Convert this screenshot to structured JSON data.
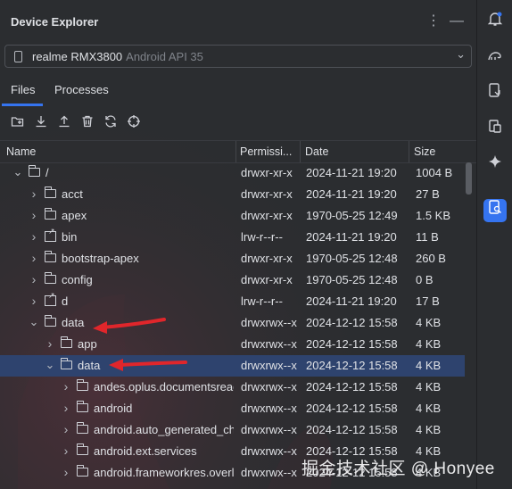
{
  "panel": {
    "title": "Device Explorer",
    "more_icon": "more-vertical-icon",
    "minimize_icon": "minimize-icon"
  },
  "device": {
    "name": "realme RMX3800",
    "api": "Android API 35"
  },
  "tabs": [
    {
      "label": "Files",
      "active": true
    },
    {
      "label": "Processes",
      "active": false
    }
  ],
  "toolbar": [
    "new-folder-icon",
    "download-icon",
    "upload-icon",
    "delete-icon",
    "sync-icon",
    "target-icon"
  ],
  "columns": [
    "Name",
    "Permissi...",
    "Date",
    "Size"
  ],
  "rows": [
    {
      "name": "/",
      "perm": "drwxr-xr-x",
      "date": "2024-11-21 19:20",
      "size": "1004 B",
      "depth": 0,
      "expanded": true,
      "type": "folder"
    },
    {
      "name": "acct",
      "perm": "drwxr-xr-x",
      "date": "2024-11-21 19:20",
      "size": "27 B",
      "depth": 1,
      "expanded": false,
      "type": "folder"
    },
    {
      "name": "apex",
      "perm": "drwxr-xr-x",
      "date": "1970-05-25 12:49",
      "size": "1.5 KB",
      "depth": 1,
      "expanded": false,
      "type": "folder"
    },
    {
      "name": "bin",
      "perm": "lrw-r--r--",
      "date": "2024-11-21 19:20",
      "size": "11 B",
      "depth": 1,
      "expanded": false,
      "type": "link"
    },
    {
      "name": "bootstrap-apex",
      "perm": "drwxr-xr-x",
      "date": "1970-05-25 12:48",
      "size": "260 B",
      "depth": 1,
      "expanded": false,
      "type": "folder"
    },
    {
      "name": "config",
      "perm": "drwxr-xr-x",
      "date": "1970-05-25 12:48",
      "size": "0 B",
      "depth": 1,
      "expanded": false,
      "type": "folder"
    },
    {
      "name": "d",
      "perm": "lrw-r--r--",
      "date": "2024-11-21 19:20",
      "size": "17 B",
      "depth": 1,
      "expanded": false,
      "type": "link"
    },
    {
      "name": "data",
      "perm": "drwxrwx--x",
      "date": "2024-12-12 15:58",
      "size": "4 KB",
      "depth": 1,
      "expanded": true,
      "type": "folder"
    },
    {
      "name": "app",
      "perm": "drwxrwx--x",
      "date": "2024-12-12 15:58",
      "size": "4 KB",
      "depth": 2,
      "expanded": false,
      "type": "folder"
    },
    {
      "name": "data",
      "perm": "drwxrwx--x",
      "date": "2024-12-12 15:58",
      "size": "4 KB",
      "depth": 2,
      "expanded": true,
      "type": "folder",
      "selected": true
    },
    {
      "name": "andes.oplus.documentsreader",
      "perm": "drwxrwx--x",
      "date": "2024-12-12 15:58",
      "size": "4 KB",
      "depth": 3,
      "expanded": false,
      "type": "folder"
    },
    {
      "name": "android",
      "perm": "drwxrwx--x",
      "date": "2024-12-12 15:58",
      "size": "4 KB",
      "depth": 3,
      "expanded": false,
      "type": "folder"
    },
    {
      "name": "android.auto_generated_characteristics_rro",
      "perm": "drwxrwx--x",
      "date": "2024-12-12 15:58",
      "size": "4 KB",
      "depth": 3,
      "expanded": false,
      "type": "folder"
    },
    {
      "name": "android.ext.services",
      "perm": "drwxrwx--x",
      "date": "2024-12-12 15:58",
      "size": "4 KB",
      "depth": 3,
      "expanded": false,
      "type": "folder"
    },
    {
      "name": "android.frameworkres.overlay",
      "perm": "drwxrwx--x",
      "date": "2024-12-12 15:58",
      "size": "4 KB",
      "depth": 3,
      "expanded": false,
      "type": "folder"
    }
  ],
  "sidebar": [
    "notifications-icon",
    "gradle-icon",
    "device-manager-icon",
    "clipboard-icon",
    "gemini-icon",
    "device-explorer-icon"
  ],
  "watermark": "掘金技术社区 @ Honyee",
  "colors": {
    "accent": "#3574f0",
    "selected_row": "#2e436e",
    "annotation": "#e0262b"
  }
}
